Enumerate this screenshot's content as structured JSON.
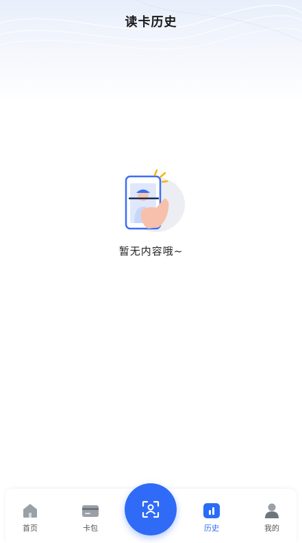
{
  "header": {
    "title": "读卡历史"
  },
  "empty_state": {
    "message": "暂无内容哦~",
    "illustration": "phone-scan-hand-icon"
  },
  "tabbar": {
    "tabs": [
      {
        "label": "首页",
        "icon": "home-icon"
      },
      {
        "label": "卡包",
        "icon": "card-icon"
      },
      {
        "label": "历史",
        "icon": "history-chart-icon",
        "active": true
      },
      {
        "label": "我的",
        "icon": "user-icon"
      }
    ],
    "center_button": {
      "icon": "scan-icon"
    }
  },
  "colors": {
    "accent": "#2f6bf6",
    "active_tab": "#2b6cf6",
    "inactive_icon": "#9aa0a8"
  }
}
